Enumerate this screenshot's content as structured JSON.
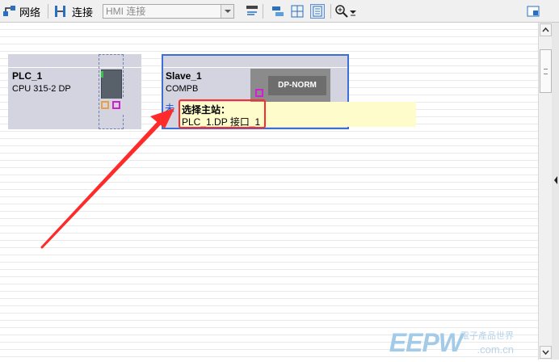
{
  "toolbar": {
    "network_label": "网络",
    "connections_label": "连接",
    "connection_type": "HMI 连接"
  },
  "devices": {
    "plc": {
      "name": "PLC_1",
      "type": "CPU 315-2 DP"
    },
    "slave": {
      "name": "Slave_1",
      "type": "COMPB",
      "module_label": "DP-NORM",
      "partial_status": "未"
    }
  },
  "tooltip": {
    "title": "选择主站：",
    "value": "PLC_1.DP 接口_1"
  },
  "watermark": {
    "logo": "EEPW",
    "tagline": "電子產品世界",
    "domain": ".com.cn"
  },
  "colors": {
    "selection_border": "#3b6fd4",
    "highlight_red": "#ff2a2a",
    "tooltip_bg": "#fffccc",
    "device_bg": "#d4d4e0",
    "port_orange": "#e8a040",
    "port_magenta": "#d020d0"
  }
}
